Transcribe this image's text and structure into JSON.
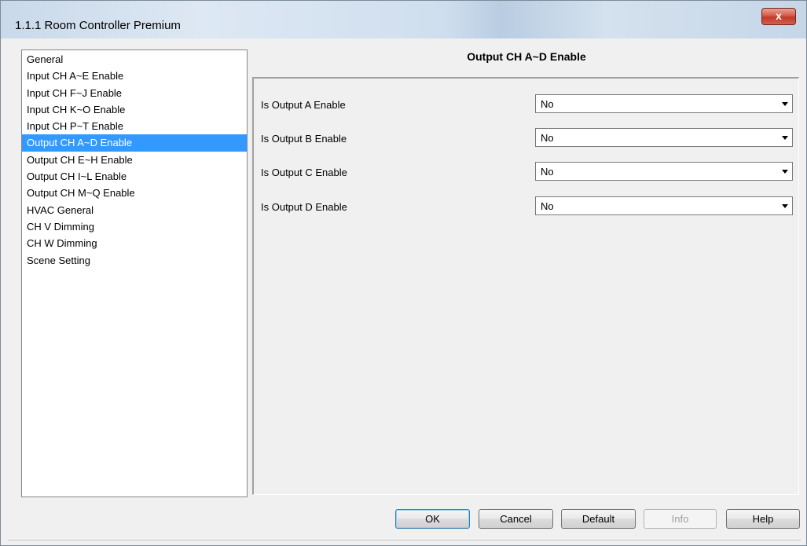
{
  "window": {
    "title": "1.1.1 Room Controller Premium",
    "close_label": "x"
  },
  "sidebar": {
    "items": [
      {
        "label": "General"
      },
      {
        "label": "Input CH A~E Enable"
      },
      {
        "label": "Input CH F~J Enable"
      },
      {
        "label": "Input CH K~O Enable"
      },
      {
        "label": "Input CH P~T Enable"
      },
      {
        "label": "Output CH A~D Enable",
        "selected": true
      },
      {
        "label": "Output CH E~H Enable"
      },
      {
        "label": "Output CH I~L Enable"
      },
      {
        "label": "Output CH M~Q Enable"
      },
      {
        "label": "HVAC General"
      },
      {
        "label": "CH V Dimming"
      },
      {
        "label": "CH W Dimming"
      },
      {
        "label": "Scene Setting"
      }
    ]
  },
  "main": {
    "section_title": "Output CH A~D Enable",
    "fields": [
      {
        "label": "Is Output A Enable",
        "value": "No"
      },
      {
        "label": "Is Output B Enable",
        "value": "No"
      },
      {
        "label": "Is Output C Enable",
        "value": "No"
      },
      {
        "label": "Is Output D Enable",
        "value": "No"
      }
    ]
  },
  "buttons": {
    "ok": "OK",
    "cancel": "Cancel",
    "default": "Default",
    "info": "Info",
    "help": "Help"
  },
  "colors": {
    "selection": "#3399ff",
    "window_bg": "#f0f0f0",
    "close_red": "#c23a28"
  }
}
